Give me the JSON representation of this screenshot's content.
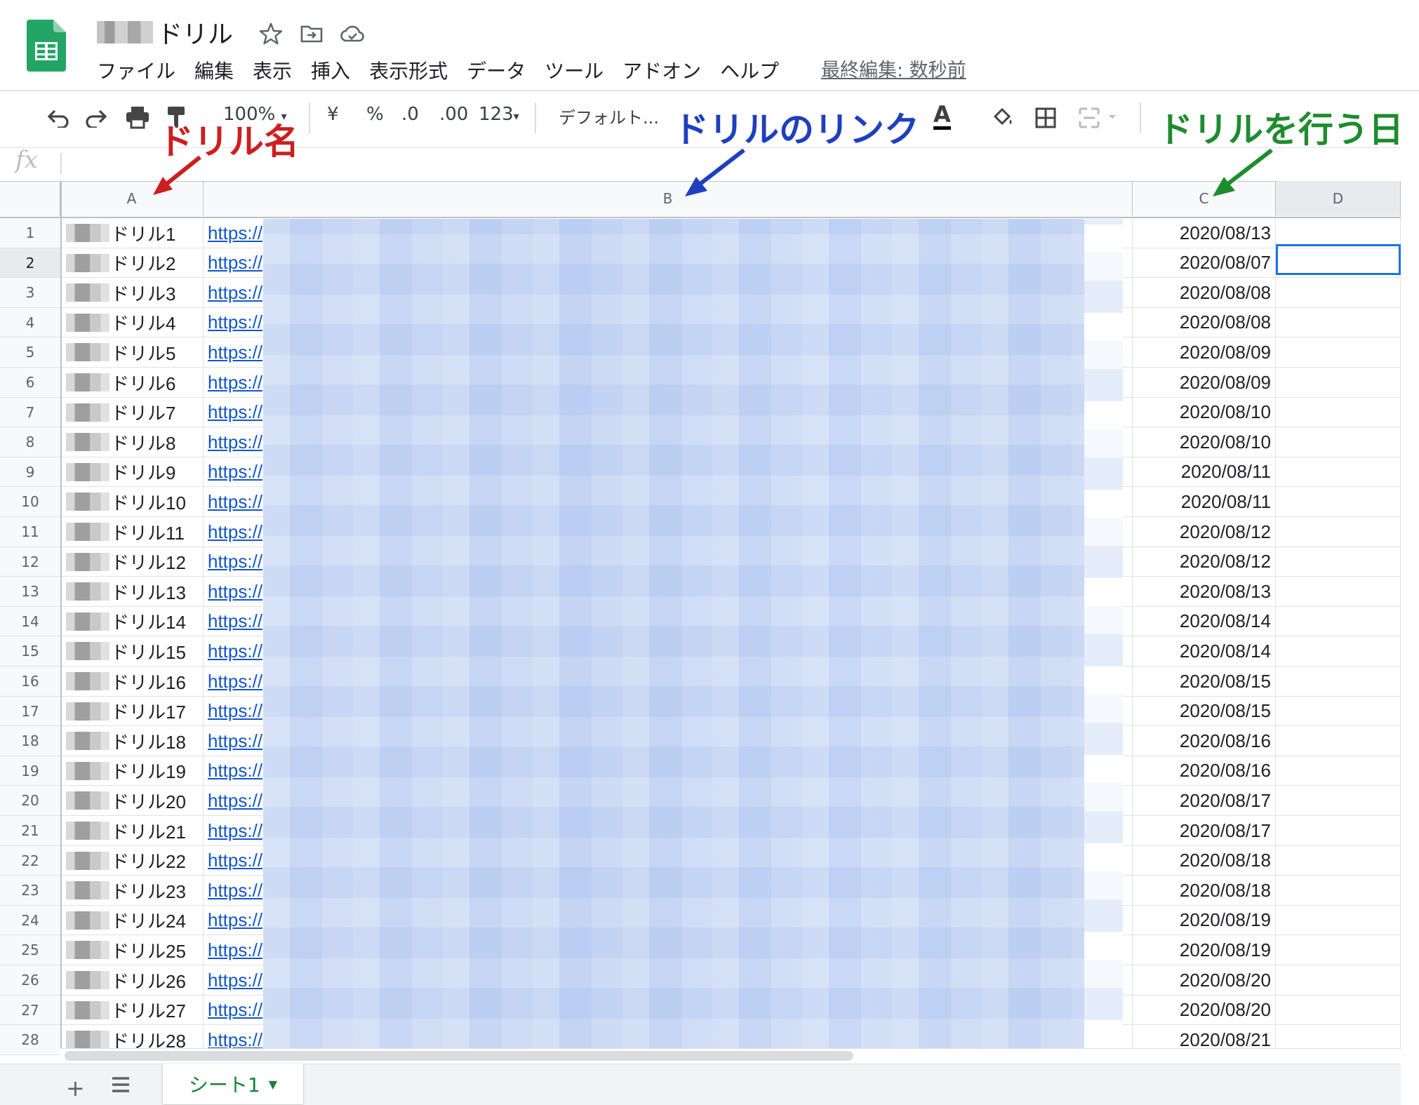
{
  "header": {
    "title": "ドリル",
    "menu": [
      "ファイル",
      "編集",
      "表示",
      "挿入",
      "表示形式",
      "データ",
      "ツール",
      "アドオン",
      "ヘルプ"
    ],
    "last_edit": "最終編集: 数秒前"
  },
  "toolbar": {
    "zoom": "100%",
    "currency": "¥",
    "percent": "%",
    "decimal_decrease": ".0",
    "decimal_increase": ".00",
    "format_more": "123",
    "font": "デフォルト..."
  },
  "formula_bar": {
    "fx": "fx",
    "value": ""
  },
  "columns": [
    "A",
    "B",
    "C",
    "D"
  ],
  "rows": [
    {
      "n": "1",
      "name": "ドリル1",
      "link": "https://",
      "date": "2020/08/13"
    },
    {
      "n": "2",
      "name": "ドリル2",
      "link": "https://",
      "date": "2020/08/07"
    },
    {
      "n": "3",
      "name": "ドリル3",
      "link": "https://",
      "date": "2020/08/08"
    },
    {
      "n": "4",
      "name": "ドリル4",
      "link": "https://",
      "date": "2020/08/08"
    },
    {
      "n": "5",
      "name": "ドリル5",
      "link": "https://",
      "date": "2020/08/09"
    },
    {
      "n": "6",
      "name": "ドリル6",
      "link": "https://",
      "date": "2020/08/09"
    },
    {
      "n": "7",
      "name": "ドリル7",
      "link": "https://",
      "date": "2020/08/10"
    },
    {
      "n": "8",
      "name": "ドリル8",
      "link": "https://",
      "date": "2020/08/10"
    },
    {
      "n": "9",
      "name": "ドリル9",
      "link": "https://",
      "date": "2020/08/11"
    },
    {
      "n": "10",
      "name": "ドリル10",
      "link": "https://",
      "date": "2020/08/11"
    },
    {
      "n": "11",
      "name": "ドリル11",
      "link": "https://",
      "date": "2020/08/12"
    },
    {
      "n": "12",
      "name": "ドリル12",
      "link": "https://",
      "date": "2020/08/12"
    },
    {
      "n": "13",
      "name": "ドリル13",
      "link": "https://",
      "date": "2020/08/13"
    },
    {
      "n": "14",
      "name": "ドリル14",
      "link": "https://",
      "date": "2020/08/14"
    },
    {
      "n": "15",
      "name": "ドリル15",
      "link": "https://",
      "date": "2020/08/14"
    },
    {
      "n": "16",
      "name": "ドリル16",
      "link": "https://",
      "date": "2020/08/15"
    },
    {
      "n": "17",
      "name": "ドリル17",
      "link": "https://",
      "date": "2020/08/15"
    },
    {
      "n": "18",
      "name": "ドリル18",
      "link": "https://",
      "date": "2020/08/16"
    },
    {
      "n": "19",
      "name": "ドリル19",
      "link": "https://",
      "date": "2020/08/16"
    },
    {
      "n": "20",
      "name": "ドリル20",
      "link": "https://",
      "date": "2020/08/17"
    },
    {
      "n": "21",
      "name": "ドリル21",
      "link": "https://",
      "date": "2020/08/17"
    },
    {
      "n": "22",
      "name": "ドリル22",
      "link": "https://",
      "date": "2020/08/18"
    },
    {
      "n": "23",
      "name": "ドリル23",
      "link": "https://",
      "date": "2020/08/18"
    },
    {
      "n": "24",
      "name": "ドリル24",
      "link": "https://",
      "date": "2020/08/19"
    },
    {
      "n": "25",
      "name": "ドリル25",
      "link": "https://",
      "date": "2020/08/19"
    },
    {
      "n": "26",
      "name": "ドリル26",
      "link": "https://",
      "date": "2020/08/20"
    },
    {
      "n": "27",
      "name": "ドリル27",
      "link": "https://",
      "date": "2020/08/20"
    },
    {
      "n": "28",
      "name": "ドリル28",
      "link": "https://",
      "date": "2020/08/21"
    }
  ],
  "sheet_tabs": {
    "add": "+",
    "active_tab": "シート1"
  },
  "annotations": {
    "col_a": "ドリル名",
    "col_b": "ドリルのリンク",
    "col_c": "ドリルを行う日"
  },
  "colors": {
    "link": "#1155cc",
    "selection": "#1a73e8",
    "annotation_a": "#cc1f1f",
    "annotation_b": "#1f3fbf",
    "annotation_c": "#1e8c2e",
    "sheets_green": "#188038"
  }
}
